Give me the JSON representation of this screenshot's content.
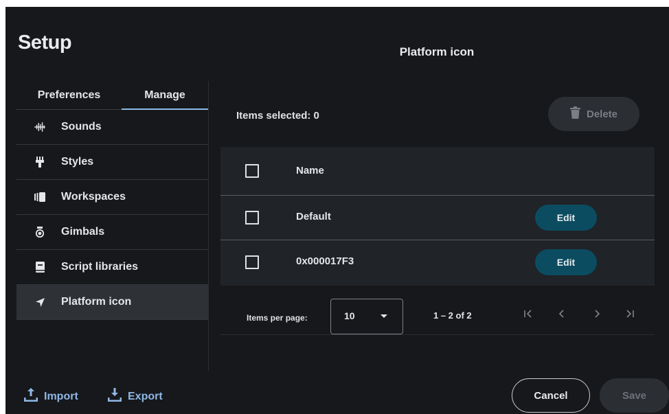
{
  "dialog": {
    "title": "Setup"
  },
  "tabs": [
    {
      "label": "Preferences",
      "active": false
    },
    {
      "label": "Manage",
      "active": true
    }
  ],
  "sidebar": {
    "items": [
      {
        "label": "Sounds",
        "icon": "waveform-icon"
      },
      {
        "label": "Styles",
        "icon": "brush-icon"
      },
      {
        "label": "Workspaces",
        "icon": "workspaces-icon"
      },
      {
        "label": "Gimbals",
        "icon": "gimbal-icon"
      },
      {
        "label": "Script libraries",
        "icon": "book-icon"
      },
      {
        "label": "Platform icon",
        "icon": "navigation-arrow-icon",
        "active": true
      }
    ]
  },
  "panel": {
    "title": "Platform icon",
    "items_selected": "Items selected: 0",
    "delete_label": "Delete",
    "table": {
      "header": {
        "name": "Name"
      },
      "rows": [
        {
          "name": "Default",
          "action": "Edit"
        },
        {
          "name": "0x000017F3",
          "action": "Edit"
        }
      ]
    },
    "pagination": {
      "items_per_page_label": "Items per page:",
      "items_per_page_value": "10",
      "range": "1 – 2 of 2"
    }
  },
  "footer": {
    "import_label": "Import",
    "export_label": "Export",
    "cancel_label": "Cancel",
    "save_label": "Save"
  },
  "colors": {
    "background": "#17181b",
    "accent": "#8fb8e6",
    "edit_button": "#0b4c61"
  }
}
